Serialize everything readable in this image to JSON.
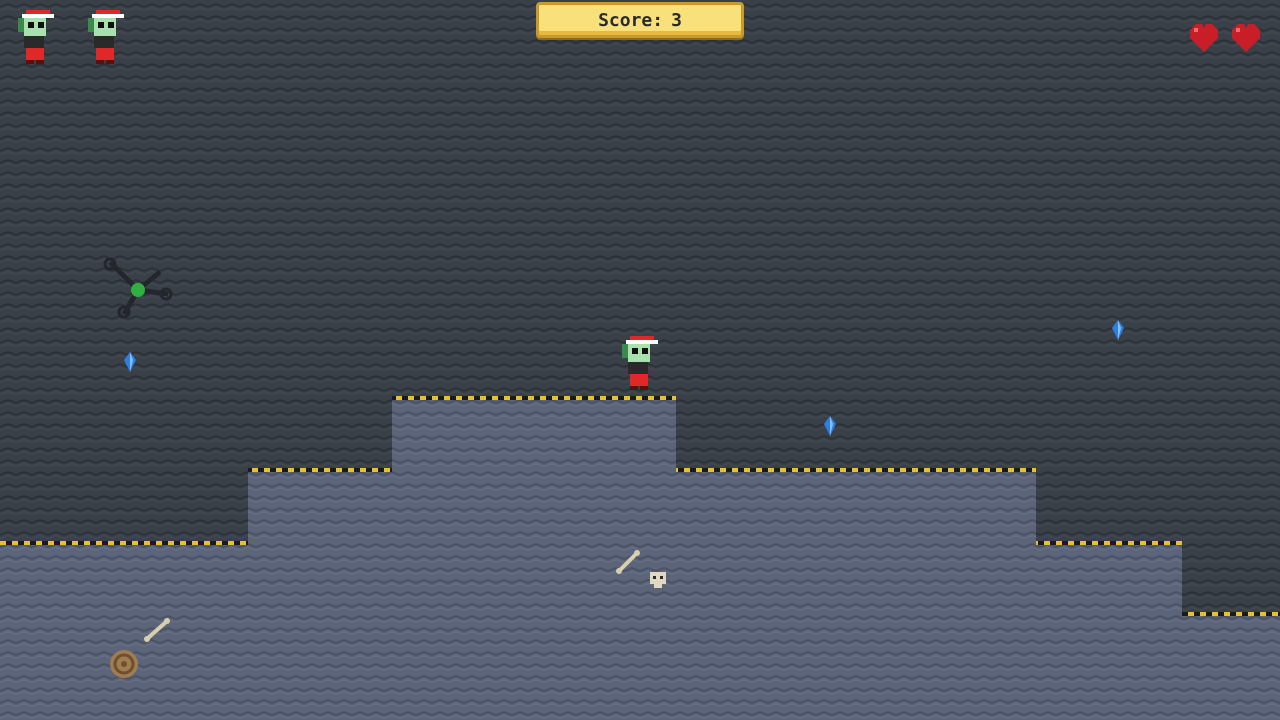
{
  "hud": {
    "score_label": "Score:",
    "score_value": "3",
    "lives_count": 2,
    "hearts_count": 2
  },
  "colors": {
    "upper_bg": "#3a4048",
    "wave_dark": "#2c3037",
    "lower_bg": "#5b6478",
    "wave_light": "#4a5266",
    "hazard_yellow": "#e8c030",
    "heart_red": "#c81e28",
    "gem_blue": "#2f7fe0"
  },
  "icons": [
    "player-life-icon",
    "heart-icon",
    "player-character",
    "blue-gem-icon",
    "spider-enemy",
    "bone-icon",
    "skull-icon",
    "snail-shell-icon"
  ]
}
